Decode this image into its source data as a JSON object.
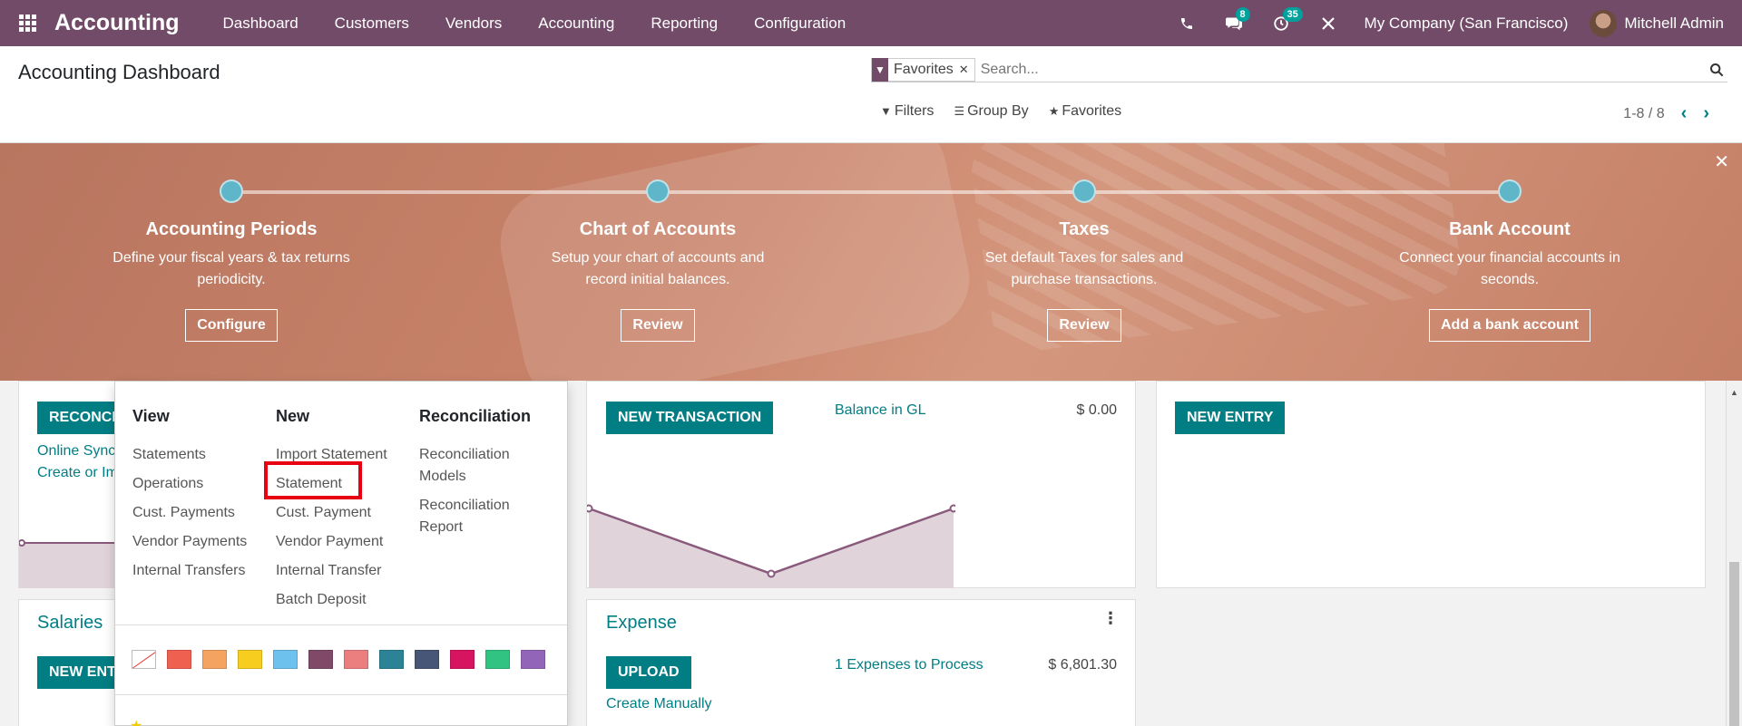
{
  "navbar": {
    "brand": "Accounting",
    "menu": [
      "Dashboard",
      "Customers",
      "Vendors",
      "Accounting",
      "Reporting",
      "Configuration"
    ],
    "messages_badge": "8",
    "activities_badge": "35",
    "company": "My Company (San Francisco)",
    "user": "Mitchell Admin"
  },
  "control_panel": {
    "title": "Accounting Dashboard",
    "facet_label": "Favorites",
    "search_placeholder": "Search...",
    "filters_label": "Filters",
    "groupby_label": "Group By",
    "favorites_label": "Favorites",
    "pager": "1-8 / 8"
  },
  "banner": {
    "steps": [
      {
        "title": "Accounting Periods",
        "desc": "Define your fiscal years & tax returns periodicity.",
        "button": "Configure"
      },
      {
        "title": "Chart of Accounts",
        "desc": "Setup your chart of accounts and record initial balances.",
        "button": "Review"
      },
      {
        "title": "Taxes",
        "desc": "Set default Taxes for sales and purchase transactions.",
        "button": "Review"
      },
      {
        "title": "Bank Account",
        "desc": "Connect your financial accounts in seconds.",
        "button": "Add a bank account"
      }
    ]
  },
  "bank_card": {
    "button": "RECONCILI",
    "link1": "Online Sync",
    "link2": "Create or Im"
  },
  "cash_card": {
    "button": "NEW TRANSACTION",
    "balance_label": "Balance in GL",
    "balance_value": "$ 0.00"
  },
  "misc_card": {
    "button": "NEW ENTRY"
  },
  "salaries_card": {
    "title": "Salaries",
    "button": "NEW ENTI"
  },
  "expense_card": {
    "title": "Expense",
    "button": "UPLOAD",
    "create_link": "Create Manually",
    "expenses_label": "1 Expenses to Process",
    "expenses_value": "$ 6,801.30"
  },
  "dropdown": {
    "view_head": "View",
    "view_items": [
      "Statements",
      "Operations",
      "Cust. Payments",
      "Vendor Payments",
      "Internal Transfers"
    ],
    "new_head": "New",
    "new_items": [
      "Import Statement",
      "Statement",
      "Cust. Payment",
      "Vendor Payment",
      "Internal Transfer",
      "Batch Deposit"
    ],
    "reco_head": "Reconciliation",
    "reco_items": [
      "Reconciliation Models",
      "Reconciliation Report"
    ],
    "swatch_colors": [
      "#ffffff",
      "#f06050",
      "#f4a460",
      "#f7cd1f",
      "#6cc1ed",
      "#814968",
      "#eb7e7f",
      "#2c8397",
      "#475577",
      "#d6145f",
      "#30c381",
      "#9365b8"
    ]
  },
  "chart_data": {
    "type": "area",
    "x": [
      0,
      1,
      2
    ],
    "series": [
      {
        "values": [
          2,
          0,
          2
        ]
      }
    ]
  }
}
